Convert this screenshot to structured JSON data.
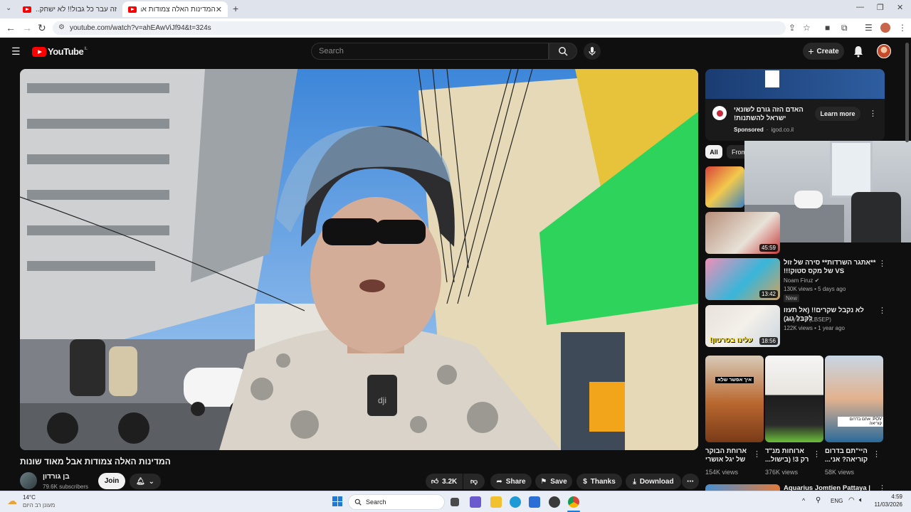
{
  "browser": {
    "tabs": [
      {
        "title": "זה עבר כל גבול!! לא ישחק...",
        "active": false
      },
      {
        "title": "המדינות האלה צמודות אבל...",
        "active": true
      }
    ],
    "url": "youtube.com/watch?v=ahEAwViJf94&t=324s"
  },
  "header": {
    "logo_text": "YouTube",
    "country": "IL",
    "search_placeholder": "Search",
    "create_label": "Create"
  },
  "video": {
    "title": "המדינות האלה צמודות אבל מאוד שונות",
    "channel": "בן גורדון",
    "subscribers": "79.6K subscribers",
    "join_label": "Join",
    "likes": "3.2K",
    "share_label": "Share",
    "save_label": "Save",
    "thanks_label": "Thanks",
    "download_label": "Download"
  },
  "ad": {
    "title": "האדם הזה גורם לשונאי ישראל להשתנות!",
    "sponsored": "Sponsored",
    "domain": "igod.co.il",
    "cta": "Learn more"
  },
  "chips": [
    "All",
    "From"
  ],
  "sidebar": {
    "videos": [
      {
        "duration": "45:59"
      },
      {
        "title": "**אתגר השרדות** סירה של זול VS של מקס סטוק!!!",
        "channel": "Noam Firuz",
        "meta": "130K views • 5 days ago",
        "badge": "New",
        "duration": "13:42"
      },
      {
        "title": "לא נקבל שקרים!! (אל תעזו לקבל גוג)",
        "channel": "Levy's Fit (LBSEP)",
        "meta": "122K views • 1 year ago",
        "duration": "18:56",
        "thumb_text": "עלינו בסרטון!"
      }
    ],
    "shorts": [
      {
        "title": "ארוחת הבוקר של יגל אושרי",
        "views": "154K views",
        "thumb_text": "איך אפשר שלא"
      },
      {
        "title": "ארוחות מנ\"ד רק 3! (בישול...",
        "views": "376K views"
      },
      {
        "title": "היי\"תם בדרום קוריאה? אני...",
        "views": "58K views",
        "thumb_text": "POV: אתם בדרום קוריאה"
      }
    ],
    "next_title": "Aquarius Jomtien Pattaya |"
  },
  "taskbar": {
    "temp": "14°C",
    "weather": "מעונן רב היום",
    "search_label": "Search",
    "lang": "ENG",
    "time": "4:59",
    "date": "11/03/2026"
  }
}
